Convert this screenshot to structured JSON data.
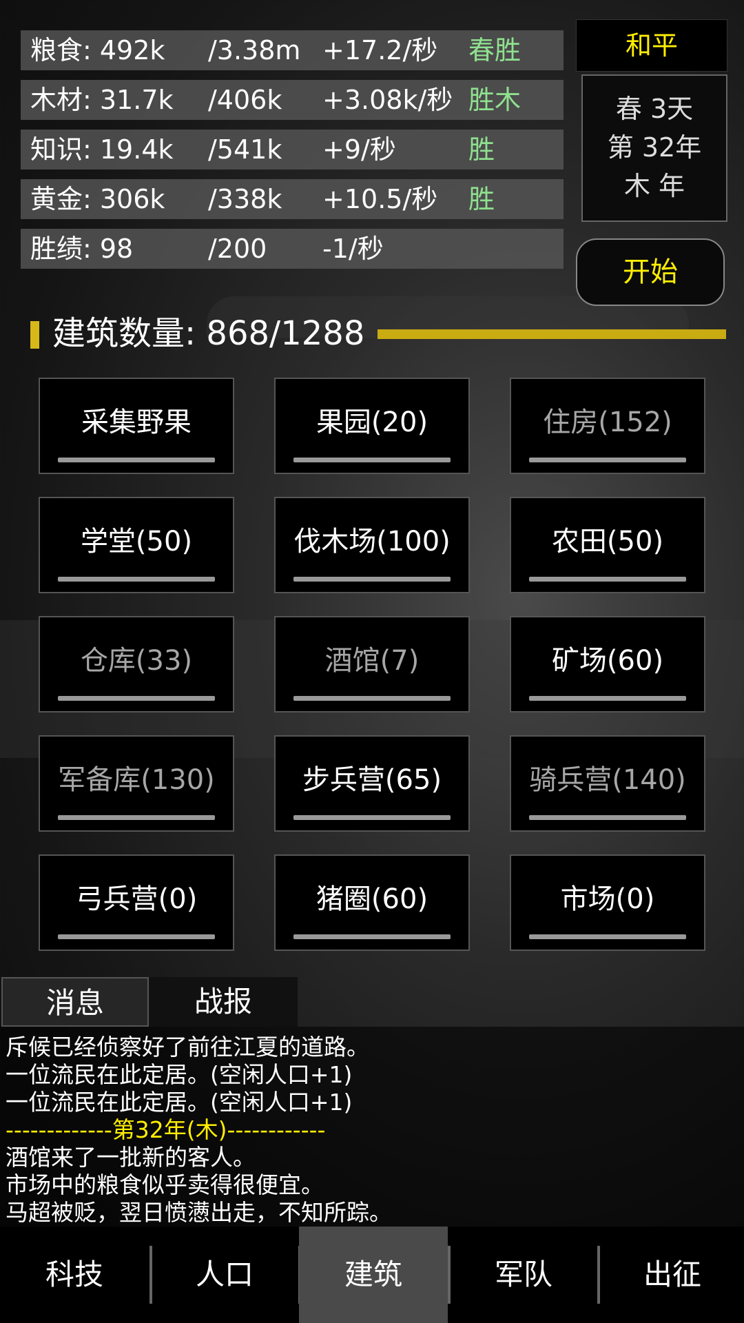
{
  "resources": [
    {
      "name": "粮食: 492k",
      "max": "/3.38m",
      "rate": "+17.2/秒",
      "bonus": "春胜"
    },
    {
      "name": "木材: 31.7k",
      "max": "/406k",
      "rate": "+3.08k/秒",
      "bonus": "胜木"
    },
    {
      "name": "知识: 19.4k",
      "max": "/541k",
      "rate": "+9/秒",
      "bonus": "胜"
    },
    {
      "name": "黄金: 306k",
      "max": "/338k",
      "rate": "+10.5/秒",
      "bonus": "胜"
    },
    {
      "name": "胜绩: 98",
      "max": "/200",
      "rate": "-1/秒",
      "bonus": ""
    }
  ],
  "status": {
    "mode": "和平",
    "date_line1": "春 3天",
    "date_line2": "第 32年",
    "date_line3": "木 年",
    "start_label": "开始"
  },
  "buildings": {
    "header": "建筑数量: 868/1288",
    "progress": 0.674,
    "items": [
      {
        "label": "采集野果",
        "enabled": true
      },
      {
        "label": "果园(20)",
        "enabled": true
      },
      {
        "label": "住房(152)",
        "enabled": false
      },
      {
        "label": "学堂(50)",
        "enabled": true
      },
      {
        "label": "伐木场(100)",
        "enabled": true
      },
      {
        "label": "农田(50)",
        "enabled": true
      },
      {
        "label": "仓库(33)",
        "enabled": false
      },
      {
        "label": "酒馆(7)",
        "enabled": false
      },
      {
        "label": "矿场(60)",
        "enabled": true
      },
      {
        "label": "军备库(130)",
        "enabled": false
      },
      {
        "label": "步兵营(65)",
        "enabled": true
      },
      {
        "label": "骑兵营(140)",
        "enabled": false
      },
      {
        "label": "弓兵营(0)",
        "enabled": true
      },
      {
        "label": "猪圈(60)",
        "enabled": true
      },
      {
        "label": "市场(0)",
        "enabled": true
      }
    ]
  },
  "log_tabs": {
    "messages": "消息",
    "battle": "战报"
  },
  "log": [
    "斥候已经侦察好了前往江夏的道路。",
    "一位流民在此定居。(空闲人口+1)",
    "一位流民在此定居。(空闲人口+1)",
    "-------------第32年(木)------------",
    "酒馆来了一批新的客人。",
    "市场中的粮食似乎卖得很便宜。",
    "马超被贬，翌日愤懑出走，不知所踪。"
  ],
  "nav": [
    "科技",
    "人口",
    "建筑",
    "军队",
    "出征"
  ],
  "nav_active": 2,
  "colors": {
    "accent": "#d6b818",
    "highlight": "#ffee00",
    "bonus": "#8fe08f"
  }
}
